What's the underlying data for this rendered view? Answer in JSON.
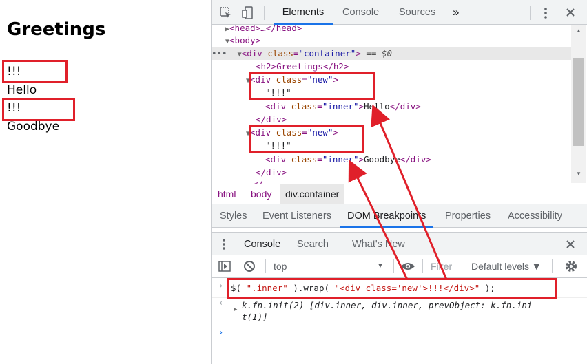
{
  "page": {
    "heading": "Greetings",
    "lines": [
      "!!!",
      "Hello",
      "!!!",
      "Goodbye"
    ]
  },
  "devtools": {
    "tabs": [
      "Elements",
      "Console",
      "Sources"
    ],
    "more_tabs_label": "»",
    "tree": {
      "head_line": "<head>…</head>",
      "body_open": "<body>",
      "container_tag_open": "<div",
      "container_attr": "class",
      "container_value": "\"container\"",
      "container_tag_close": ">",
      "container_marker": "== $0",
      "h2_line": "<h2>Greetings</h2>",
      "new_tag_open": "<div",
      "new_attr": "class",
      "new_value": "\"new\"",
      "new_tag_close": ">",
      "bang_text": "\"!!!\"",
      "inner_tag_open": "<div",
      "inner_attr": "class",
      "inner_value": "\"inner\"",
      "inner_close_bracket": ">",
      "hello_text": "Hello",
      "goodbye_text": "Goodbye",
      "div_end": "</div>",
      "partial_line": "</..."
    },
    "breadcrumbs": [
      "html",
      "body",
      "div.container"
    ],
    "sidebar_tabs": [
      "Styles",
      "Event Listeners",
      "DOM Breakpoints",
      "Properties",
      "Accessibility"
    ],
    "drawer_tabs": [
      "Console",
      "Search",
      "What's New"
    ],
    "console_toolbar": {
      "context": "top",
      "filter_placeholder": "Filter",
      "levels": "Default levels ▼"
    },
    "console": {
      "input_prefix": "$( ",
      "input_selector": "\".inner\"",
      "input_mid": " ).wrap( ",
      "input_html": "\"<div class='new'>!!!</div>\"",
      "input_suffix": " );",
      "output_line1": "k.fn.init(2) [div.inner, div.inner, prevObject: k.fn.ini",
      "output_line2": "t(1)]"
    },
    "colors": {
      "accent": "#1a73e8",
      "annotation": "#e0202a",
      "tag": "#881280",
      "attr": "#994500",
      "value": "#1a1aa6"
    }
  }
}
